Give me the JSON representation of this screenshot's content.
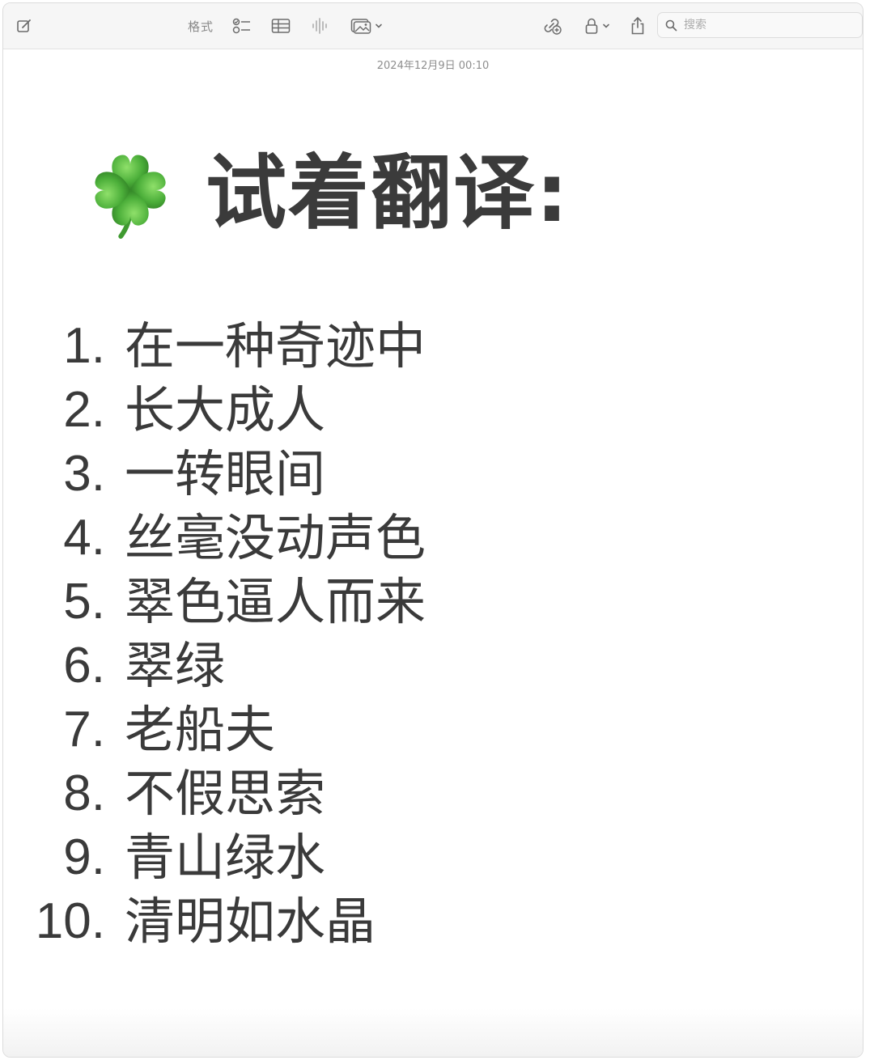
{
  "toolbar": {
    "format_label": "格式",
    "search_placeholder": "搜索"
  },
  "note": {
    "date": "2024年12月9日 00:10",
    "title": "试着翻译:",
    "title_icon": "four-leaf-clover-icon",
    "items": [
      {
        "num": "1.",
        "text": "在一种奇迹中"
      },
      {
        "num": "2.",
        "text": "长大成人"
      },
      {
        "num": "3.",
        "text": "一转眼间"
      },
      {
        "num": "4.",
        "text": "丝毫没动声色"
      },
      {
        "num": "5.",
        "text": "翠色逼人而来"
      },
      {
        "num": "6.",
        "text": "翠绿"
      },
      {
        "num": "7.",
        "text": "老船夫"
      },
      {
        "num": "8.",
        "text": "不假思索"
      },
      {
        "num": "9.",
        "text": "青山绿水"
      },
      {
        "num": "10.",
        "text": "清明如水晶"
      }
    ]
  },
  "colors": {
    "clover": "#4caf3a",
    "text": "#3a3a3a",
    "toolbar_bg": "#f6f6f6"
  }
}
